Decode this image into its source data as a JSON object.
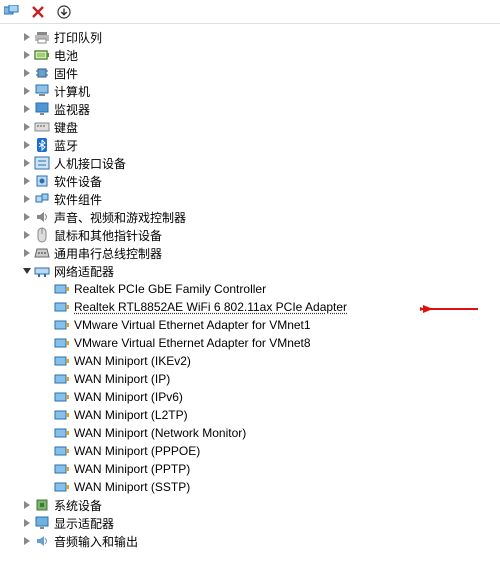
{
  "toolbar": {
    "icons": [
      "monitors-icon",
      "close-red-icon",
      "arrow-down-icon"
    ]
  },
  "tree": [
    {
      "level": 1,
      "expander": "right",
      "icon": "printer",
      "label": "打印队列"
    },
    {
      "level": 1,
      "expander": "right",
      "icon": "battery",
      "label": "电池"
    },
    {
      "level": 1,
      "expander": "right",
      "icon": "firmware",
      "label": "固件"
    },
    {
      "level": 1,
      "expander": "right",
      "icon": "computer",
      "label": "计算机"
    },
    {
      "level": 1,
      "expander": "right",
      "icon": "monitor",
      "label": "监视器"
    },
    {
      "level": 1,
      "expander": "right",
      "icon": "keyboard",
      "label": "键盘"
    },
    {
      "level": 1,
      "expander": "right",
      "icon": "bluetooth",
      "label": "蓝牙"
    },
    {
      "level": 1,
      "expander": "right",
      "icon": "hid",
      "label": "人机接口设备"
    },
    {
      "level": 1,
      "expander": "right",
      "icon": "software",
      "label": "软件设备"
    },
    {
      "level": 1,
      "expander": "right",
      "icon": "software-comp",
      "label": "软件组件"
    },
    {
      "level": 1,
      "expander": "right",
      "icon": "audio",
      "label": "声音、视频和游戏控制器"
    },
    {
      "level": 1,
      "expander": "right",
      "icon": "mouse",
      "label": "鼠标和其他指针设备"
    },
    {
      "level": 1,
      "expander": "right",
      "icon": "serial",
      "label": "通用串行总线控制器"
    },
    {
      "level": 1,
      "expander": "down",
      "icon": "network",
      "label": "网络适配器"
    },
    {
      "level": 2,
      "expander": "",
      "icon": "nic",
      "label": "Realtek PCIe GbE Family Controller"
    },
    {
      "level": 2,
      "expander": "",
      "icon": "nic",
      "label": "Realtek RTL8852AE WiFi 6 802.11ax PCIe Adapter",
      "underline": true
    },
    {
      "level": 2,
      "expander": "",
      "icon": "nic",
      "label": "VMware Virtual Ethernet Adapter for VMnet1"
    },
    {
      "level": 2,
      "expander": "",
      "icon": "nic",
      "label": "VMware Virtual Ethernet Adapter for VMnet8"
    },
    {
      "level": 2,
      "expander": "",
      "icon": "nic",
      "label": "WAN Miniport (IKEv2)"
    },
    {
      "level": 2,
      "expander": "",
      "icon": "nic",
      "label": "WAN Miniport (IP)"
    },
    {
      "level": 2,
      "expander": "",
      "icon": "nic",
      "label": "WAN Miniport (IPv6)"
    },
    {
      "level": 2,
      "expander": "",
      "icon": "nic",
      "label": "WAN Miniport (L2TP)"
    },
    {
      "level": 2,
      "expander": "",
      "icon": "nic",
      "label": "WAN Miniport (Network Monitor)"
    },
    {
      "level": 2,
      "expander": "",
      "icon": "nic",
      "label": "WAN Miniport (PPPOE)"
    },
    {
      "level": 2,
      "expander": "",
      "icon": "nic",
      "label": "WAN Miniport (PPTP)"
    },
    {
      "level": 2,
      "expander": "",
      "icon": "nic",
      "label": "WAN Miniport (SSTP)"
    },
    {
      "level": 1,
      "expander": "right",
      "icon": "system",
      "label": "系统设备"
    },
    {
      "level": 1,
      "expander": "right",
      "icon": "display",
      "label": "显示适配器"
    },
    {
      "level": 1,
      "expander": "right",
      "icon": "audioio",
      "label": "音频输入和输出"
    }
  ]
}
